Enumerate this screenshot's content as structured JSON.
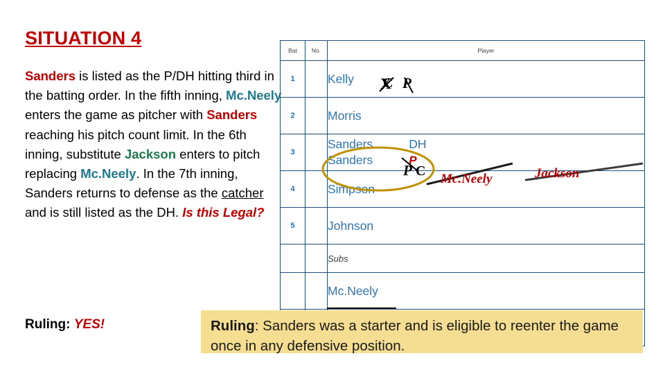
{
  "slide": {
    "title": "SITUATION 4",
    "body_segments": [
      {
        "text": "Sanders",
        "style": "red"
      },
      {
        "text": " is listed as the P/DH hitting third in the batting order. In the fifth inning, ",
        "style": "plain"
      },
      {
        "text": "Mc.Neely",
        "style": "teal"
      },
      {
        "text": " enters the game as pitcher with ",
        "style": "plain"
      },
      {
        "text": "Sanders",
        "style": "red"
      },
      {
        "text": " reaching his pitch count limit. In the 6th inning, substitute ",
        "style": "plain"
      },
      {
        "text": "Jackson",
        "style": "green"
      },
      {
        "text": " enters to pitch replacing ",
        "style": "plain"
      },
      {
        "text": "Mc.Neely",
        "style": "teal"
      },
      {
        "text": ". In the 7th inning, Sanders returns to defense as the ",
        "style": "plain"
      },
      {
        "text": "catcher",
        "style": "underline"
      },
      {
        "text": " and is still listed as the DH. ",
        "style": "plain"
      },
      {
        "text": "Is this Legal?",
        "style": "red-bold-italic"
      }
    ],
    "ruling_left_label": "Ruling:",
    "ruling_left_value": "YES!"
  },
  "lineup": {
    "headers": {
      "bat": "Bat",
      "no": "No.",
      "player": "Player"
    },
    "rows": [
      {
        "bat": "1",
        "no": "",
        "player": "Kelly",
        "position": "",
        "second_line": "",
        "second_position": ""
      },
      {
        "bat": "2",
        "no": "",
        "player": "Morris",
        "position": "",
        "second_line": "",
        "second_position": ""
      },
      {
        "bat": "3",
        "no": "",
        "player": "Sanders",
        "position": "DH",
        "second_line": "Sanders",
        "second_position": "P"
      },
      {
        "bat": "4",
        "no": "",
        "player": "Simpson",
        "position": "",
        "second_line": "",
        "second_position": ""
      },
      {
        "bat": "5",
        "no": "",
        "player": "Johnson",
        "position": "",
        "second_line": "",
        "second_position": ""
      },
      {
        "bat": "",
        "no": "",
        "player": "Subs",
        "position": "",
        "second_line": "",
        "second_position": "",
        "is_subs": true
      },
      {
        "bat": "",
        "no": "",
        "player": "Mc.Neely",
        "position": "",
        "second_line": "",
        "second_position": ""
      }
    ]
  },
  "annotations": {
    "kelly_x": "X",
    "kelly_c": "C",
    "kelly_p": "P",
    "sanders_p_strike": "P",
    "sanders_c": "C",
    "ink_mcneely": "Mc.Neely",
    "ink_jackson": "Jackson"
  },
  "ruling_callout": {
    "label": "Ruling",
    "text": ": Sanders was a starter and is eligible to reenter the game once in any defensive position."
  },
  "colors": {
    "title_red": "#c00000",
    "table_blue": "#2e75b6",
    "border_blue": "#1f4e79",
    "callout_bg": "#f5dd91",
    "teal": "#1f7a8c",
    "green": "#217a4b",
    "ink_circle": "#bf9000"
  }
}
